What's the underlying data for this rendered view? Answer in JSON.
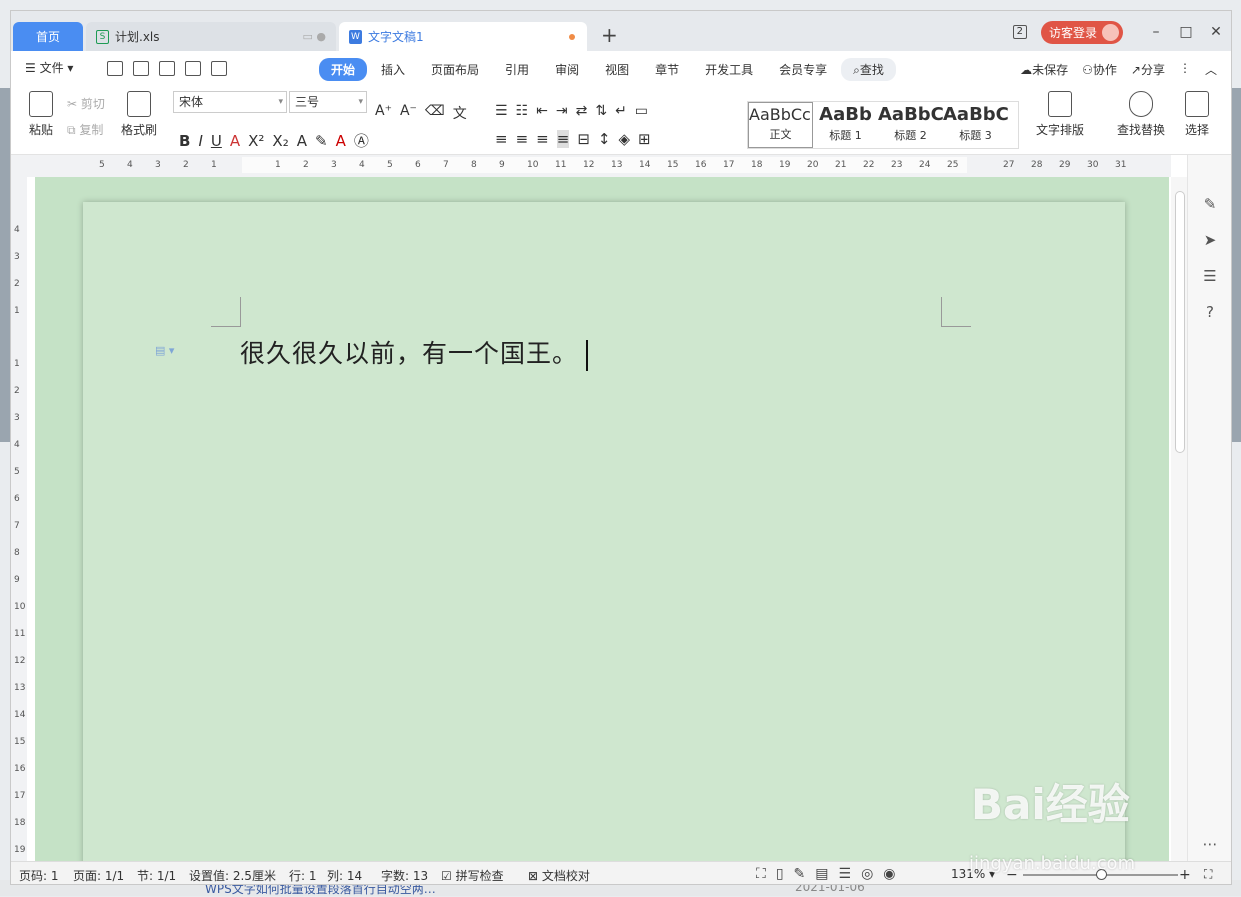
{
  "tabs": {
    "home": "首页",
    "xls": "计划.xls",
    "doc": "文字文稿1",
    "new": "+"
  },
  "titlebar": {
    "badge": "2",
    "login": "访客登录",
    "minimize": "–",
    "maximize": "□",
    "close": "✕"
  },
  "menu": {
    "file": "文件",
    "ribbon_tabs": [
      "开始",
      "插入",
      "页面布局",
      "引用",
      "审阅",
      "视图",
      "章节",
      "开发工具",
      "会员专享"
    ],
    "find": "查找",
    "unsaved": "未保存",
    "collab": "协作",
    "share": "分享"
  },
  "ribbon": {
    "paste": "粘贴",
    "cut": "剪切",
    "copy": "复制",
    "format_painter": "格式刷",
    "font": "宋体",
    "size": "三号",
    "styles": [
      {
        "preview": "AaBbCcI",
        "label": "正文"
      },
      {
        "preview": "AaBb",
        "label": "标题 1"
      },
      {
        "preview": "AaBbC",
        "label": "标题 2"
      },
      {
        "preview": "AaBbCc",
        "label": "标题 3"
      }
    ],
    "text_layout": "文字排版",
    "find_replace": "查找替换",
    "select": "选择"
  },
  "ruler": {
    "h": [
      "5",
      "4",
      "3",
      "2",
      "1",
      "1",
      "2",
      "3",
      "4",
      "5",
      "6",
      "7",
      "8",
      "9",
      "10",
      "11",
      "12",
      "13",
      "14",
      "15",
      "16",
      "17",
      "18",
      "19",
      "20",
      "21",
      "22",
      "23",
      "24",
      "25",
      "27",
      "28",
      "29",
      "30",
      "31"
    ],
    "v": [
      "4",
      "3",
      "2",
      "1",
      "1",
      "2",
      "3",
      "4",
      "5",
      "6",
      "7",
      "8",
      "9",
      "10",
      "11",
      "12",
      "13",
      "14",
      "15",
      "16",
      "17",
      "18",
      "19"
    ]
  },
  "document": {
    "text": "很久很久以前，有一个国王。"
  },
  "status": {
    "page_no": "页码: 1",
    "pages": "页面: 1/1",
    "section": "节: 1/1",
    "setting": "设置值: 2.5厘米",
    "row": "行: 1",
    "col": "列: 14",
    "words": "字数: 13",
    "spell": "拼写检查",
    "proof": "文档校对",
    "zoom": "131%"
  },
  "watermark": {
    "brand": "Bai经验",
    "url": "jingyan.baidu.com"
  },
  "background": {
    "link": "WPS文字如何批量设置段落首行自动空两…",
    "date": "2021-01-06"
  }
}
